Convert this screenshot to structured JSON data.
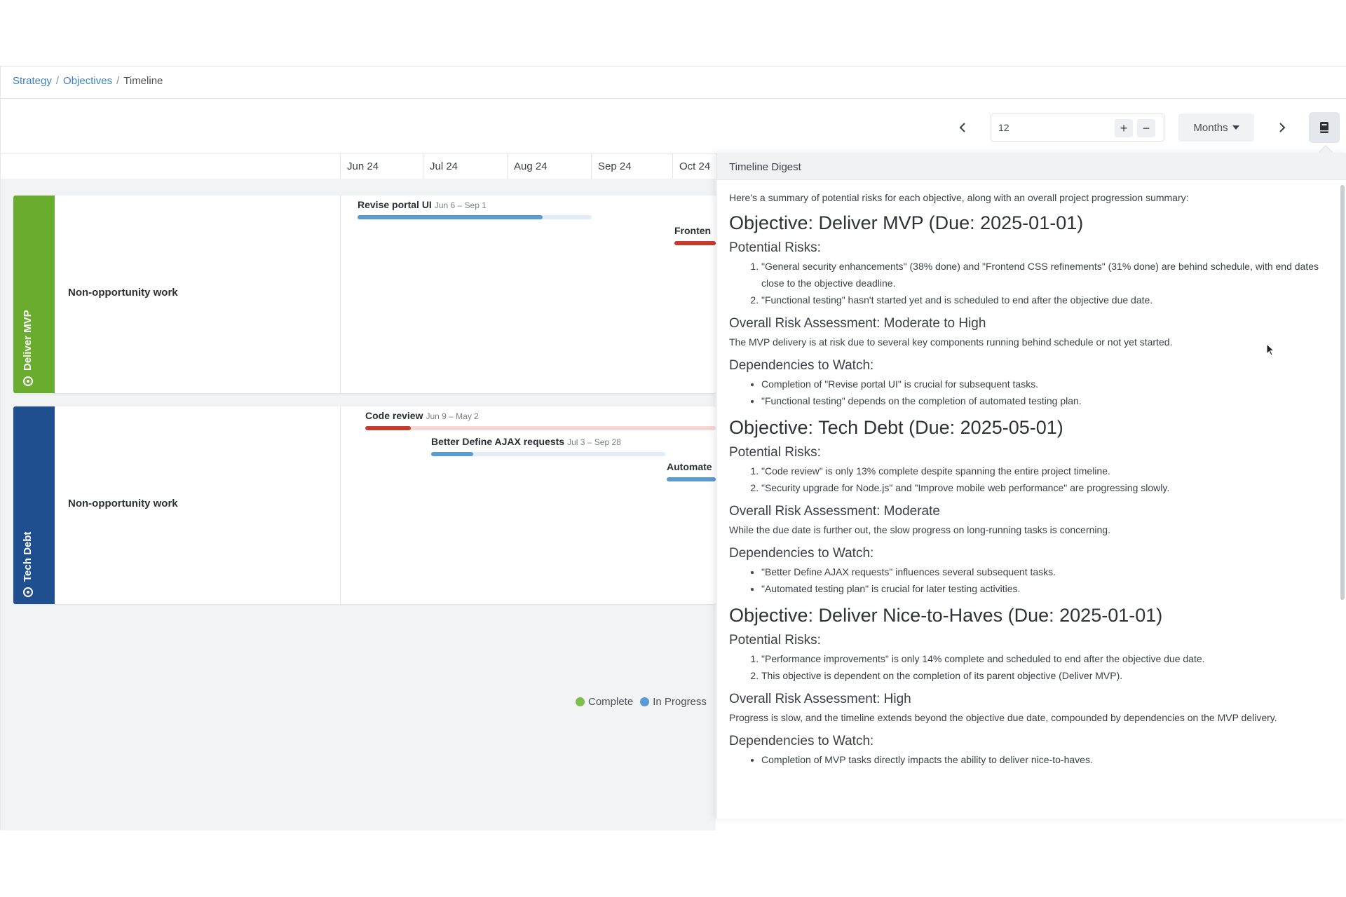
{
  "breadcrumb": {
    "items": [
      "Strategy",
      "Objectives"
    ],
    "current": "Timeline"
  },
  "toolbar": {
    "range_value": "12",
    "plus": "+",
    "minus": "−",
    "unit": "Months"
  },
  "months": [
    "Jun 24",
    "Jul 24",
    "Aug 24",
    "Sep 24",
    "Oct 24"
  ],
  "objectives": [
    {
      "name": "Deliver MVP",
      "color": "#6aad2e",
      "row_label": "Non-opportunity work",
      "tasks": [
        {
          "name": "Revise portal UI",
          "dates": "Jun 6 – Sep 1",
          "progress": 0.79,
          "bar_color": "#5b9bd5"
        },
        {
          "name": "Fronten",
          "dates": "",
          "progress": 1.0,
          "bar_color": "#c43d2e"
        }
      ]
    },
    {
      "name": "Tech Debt",
      "color": "#1f4f8f",
      "row_label": "Non-opportunity work",
      "tasks": [
        {
          "name": "Code review",
          "dates": "Jun 9 – May 2",
          "progress": 0.13,
          "bar_color": "#c43d2e"
        },
        {
          "name": "Better Define AJAX requests",
          "dates": "Jul 3 – Sep 28",
          "progress": 0.18,
          "bar_color": "#5b9bd5"
        },
        {
          "name": "Automate",
          "dates": "",
          "progress": 1.0,
          "bar_color": "#5b9bd5"
        }
      ]
    }
  ],
  "legend": [
    {
      "label": "Complete",
      "color": "#7dbf4a"
    },
    {
      "label": "In Progress",
      "color": "#5b9bd5"
    }
  ],
  "digest": {
    "header": "Timeline Digest",
    "intro": "Here's a summary of potential risks for each objective, along with an overall project progression summary:",
    "sections": [
      {
        "title": "Objective: Deliver MVP (Due: 2025-01-01)",
        "risks_title": "Potential Risks:",
        "risks": [
          "\"General security enhancements\" (38% done) and \"Frontend CSS refinements\" (31% done) are behind schedule, with end dates close to the objective deadline.",
          "\"Functional testing\" hasn't started yet and is scheduled to end after the objective due date."
        ],
        "assessment_title": "Overall Risk Assessment: Moderate to High",
        "assessment": "The MVP delivery is at risk due to several key components running behind schedule or not yet started.",
        "deps_title": "Dependencies to Watch:",
        "deps": [
          "Completion of \"Revise portal UI\" is crucial for subsequent tasks.",
          "\"Functional testing\" depends on the completion of automated testing plan."
        ]
      },
      {
        "title": "Objective: Tech Debt (Due: 2025-05-01)",
        "risks_title": "Potential Risks:",
        "risks": [
          "\"Code review\" is only 13% complete despite spanning the entire project timeline.",
          "\"Security upgrade for Node.js\" and \"Improve mobile web performance\" are progressing slowly."
        ],
        "assessment_title": "Overall Risk Assessment: Moderate",
        "assessment": "While the due date is further out, the slow progress on long-running tasks is concerning.",
        "deps_title": "Dependencies to Watch:",
        "deps": [
          "\"Better Define AJAX requests\" influences several subsequent tasks.",
          "\"Automated testing plan\" is crucial for later testing activities."
        ]
      },
      {
        "title": "Objective: Deliver Nice-to-Haves (Due: 2025-01-01)",
        "risks_title": "Potential Risks:",
        "risks": [
          "\"Performance improvements\" is only 14% complete and scheduled to end after the objective due date.",
          "This objective is dependent on the completion of its parent objective (Deliver MVP)."
        ],
        "assessment_title": "Overall Risk Assessment: High",
        "assessment": "Progress is slow, and the timeline extends beyond the objective due date, compounded by dependencies on the MVP delivery.",
        "deps_title": "Dependencies to Watch:",
        "deps": [
          "Completion of MVP tasks directly impacts the ability to deliver nice-to-haves."
        ]
      }
    ]
  }
}
